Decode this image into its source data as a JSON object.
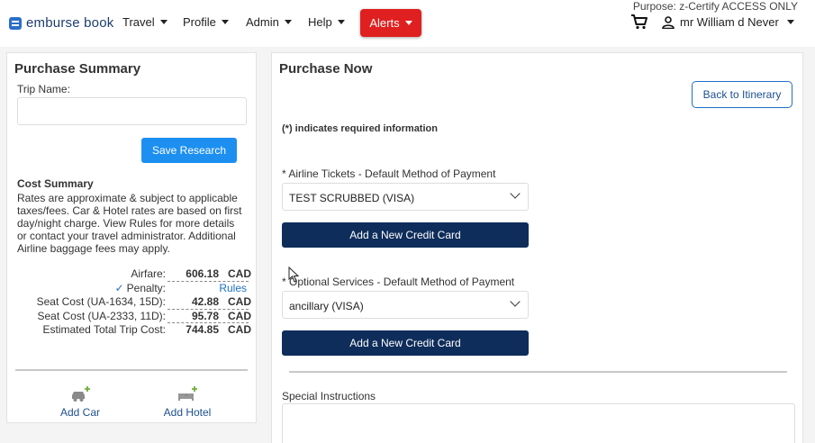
{
  "header": {
    "brand": "emburse book",
    "nav": [
      {
        "label": "Travel"
      },
      {
        "label": "Profile"
      },
      {
        "label": "Admin"
      },
      {
        "label": "Help"
      }
    ],
    "alerts_label": "Alerts",
    "purpose_text": "Purpose: z-Certify ACCESS ONLY",
    "user_name": "mr William d Never",
    "colors": {
      "alerts_bg": "#e02020",
      "brand": "#1d3d6e"
    }
  },
  "purchase_summary": {
    "title": "Purchase Summary",
    "trip_name_label": "Trip Name:",
    "trip_name_value": "",
    "save_button": "Save Research",
    "cost_summary_heading": "Cost Summary",
    "cost_note": "Rates are approximate & subject to applicable taxes/fees.  Car & Hotel rates are based on first day/night charge. View Rules for more details or contact your travel administrator. Additional Airline baggage fees may apply.",
    "rows": {
      "airfare": {
        "label": "Airfare:",
        "amount": "606.18",
        "currency": "CAD"
      },
      "penalty": {
        "label": "Penalty:",
        "link": "Rules"
      },
      "seat1": {
        "label": "Seat Cost (UA-1634, 15D):",
        "amount": "42.88",
        "currency": "CAD"
      },
      "seat2": {
        "label": "Seat Cost (UA-2333, 11D):",
        "amount": "95.78",
        "currency": "CAD"
      },
      "total": {
        "label": "Estimated Total Trip Cost:",
        "amount": "744.85",
        "currency": "CAD"
      }
    },
    "add_car": "Add Car",
    "add_hotel": "Add Hotel"
  },
  "purchase_now": {
    "title": "Purchase Now",
    "back_button": "Back to Itinerary",
    "required_note": "(*) indicates required information",
    "airline_label": "* Airline Tickets - Default Method of Payment",
    "airline_selected": "TEST SCRUBBED (VISA)",
    "add_card_1": "Add a New Credit Card",
    "optional_label": "* Optional Services - Default Method of Payment",
    "optional_selected": "ancillary (VISA)",
    "add_card_2": "Add a New Credit Card",
    "special_instructions_label": "Special Instructions",
    "colors": {
      "navy_button": "#0e2d5a",
      "blue_button": "#1d8ff0"
    }
  }
}
